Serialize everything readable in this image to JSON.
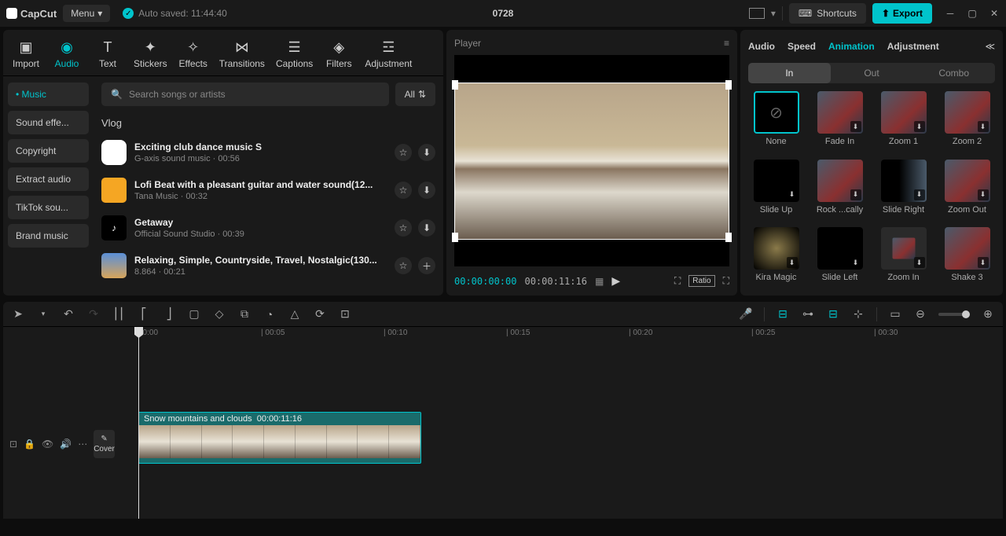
{
  "app": {
    "name": "CapCut",
    "menu_label": "Menu",
    "autosave": "Auto saved: 11:44:40",
    "project_title": "0728"
  },
  "titlebar": {
    "shortcuts": "Shortcuts",
    "export": "Export"
  },
  "topTabs": [
    {
      "label": "Import"
    },
    {
      "label": "Audio"
    },
    {
      "label": "Text"
    },
    {
      "label": "Stickers"
    },
    {
      "label": "Effects"
    },
    {
      "label": "Transitions"
    },
    {
      "label": "Captions"
    },
    {
      "label": "Filters"
    },
    {
      "label": "Adjustment"
    }
  ],
  "sidebar": {
    "items": [
      {
        "label": "Music"
      },
      {
        "label": "Sound effe..."
      },
      {
        "label": "Copyright"
      },
      {
        "label": "Extract audio"
      },
      {
        "label": "TikTok sou..."
      },
      {
        "label": "Brand music"
      }
    ]
  },
  "search": {
    "placeholder": "Search songs or artists",
    "all_label": "All"
  },
  "audioSection": {
    "title": "Vlog"
  },
  "audioItems": [
    {
      "title": "Exciting club dance music S",
      "meta": "G-axis sound music · 00:56",
      "thumb": "#ffffff"
    },
    {
      "title": "Lofi Beat with a pleasant guitar and water sound(12...",
      "meta": "Tana Music · 00:32",
      "thumb": "#f5a623"
    },
    {
      "title": "Getaway",
      "meta": "Official Sound Studio · 00:39",
      "thumb": "#000000"
    },
    {
      "title": "Relaxing, Simple, Countryside, Travel, Nostalgic(130...",
      "meta": "8.864 · 00:21",
      "thumb": "#5a8fd8"
    }
  ],
  "player": {
    "title": "Player",
    "current": "00:00:00:00",
    "total": "00:00:11:16",
    "ratio": "Ratio"
  },
  "rightTabs": [
    {
      "label": "Audio"
    },
    {
      "label": "Speed"
    },
    {
      "label": "Animation"
    },
    {
      "label": "Adjustment"
    }
  ],
  "subTabs": [
    {
      "label": "In"
    },
    {
      "label": "Out"
    },
    {
      "label": "Combo"
    }
  ],
  "animations": [
    {
      "label": "None",
      "none": true
    },
    {
      "label": "Fade In"
    },
    {
      "label": "Zoom 1"
    },
    {
      "label": "Zoom 2"
    },
    {
      "label": "Slide Up"
    },
    {
      "label": "Rock ...cally"
    },
    {
      "label": "Slide Right"
    },
    {
      "label": "Zoom Out"
    },
    {
      "label": "Kira Magic"
    },
    {
      "label": "Slide Left"
    },
    {
      "label": "Zoom In"
    },
    {
      "label": "Shake 3"
    }
  ],
  "timeline": {
    "ticks": [
      "00:00",
      "00:05",
      "00:10",
      "00:15",
      "00:20",
      "00:25",
      "00:30"
    ],
    "clip_title": "Snow mountains and clouds",
    "clip_time": "00:00:11:16",
    "cover": "Cover"
  }
}
